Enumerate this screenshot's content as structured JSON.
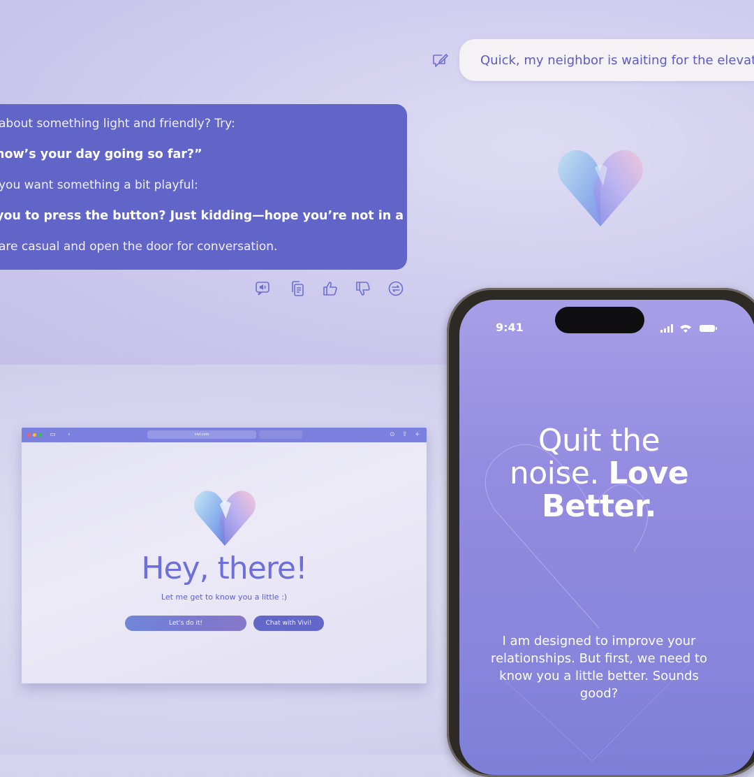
{
  "chat": {
    "user_message": "Quick, my neighbor is waiting for the elevator, w",
    "assistant_lines": [
      "about something light and friendly? Try:",
      " how’s your day going so far?”",
      "you want something a bit playful:",
      " you to press the button? Just kidding—hope you’re not in a rush!”",
      "are casual and open the door for conversation."
    ],
    "actions": [
      "speaker-icon",
      "copy-icon",
      "thumbs-up-icon",
      "thumbs-down-icon",
      "regenerate-icon"
    ]
  },
  "browser": {
    "url": "vivi.com",
    "title": "Hey, there!",
    "subtitle": "Let me get to know you a little :)",
    "primary_button": "Let’s do it!",
    "secondary_button": "Chat with Vivi!"
  },
  "phone": {
    "time": "9:41",
    "title_light_1": "Quit the",
    "title_light_2": "noise.",
    "title_bold_1": "Love",
    "title_bold_2": "Better.",
    "body": "I am designed to improve your relationships. But first, we need to know you a little better. Sounds good?"
  },
  "colors": {
    "accent": "#6165c8",
    "user_bubble": "#f4f2f5",
    "phone_screen": "#948ce0"
  }
}
